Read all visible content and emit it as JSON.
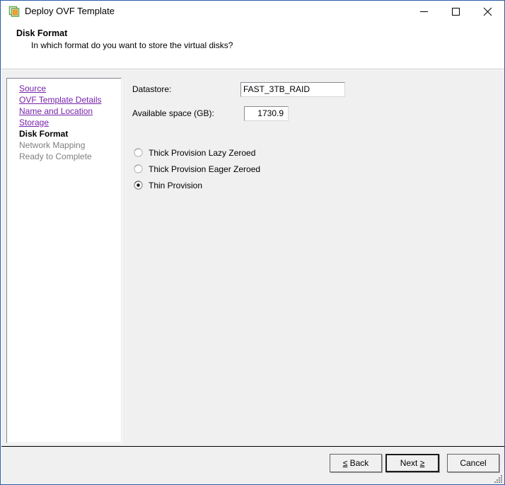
{
  "window": {
    "title": "Deploy OVF Template",
    "icon": "ovf-template-icon",
    "controls": {
      "minimize_label": "Minimize",
      "maximize_label": "Maximize",
      "close_label": "Close"
    },
    "border_color": "#2b5ea7"
  },
  "header": {
    "title": "Disk Format",
    "subtitle": "In which format do you want to store the virtual disks?"
  },
  "nav": {
    "items": [
      {
        "label": "Source",
        "state": "link"
      },
      {
        "label": "OVF Template Details",
        "state": "link"
      },
      {
        "label": "Name and Location",
        "state": "link"
      },
      {
        "label": "Storage",
        "state": "link"
      },
      {
        "label": "Disk Format",
        "state": "current"
      },
      {
        "label": "Network Mapping",
        "state": "pending"
      },
      {
        "label": "Ready to Complete",
        "state": "pending"
      }
    ],
    "link_color": "#7722aa",
    "pending_color": "#808080"
  },
  "form": {
    "datastore": {
      "label": "Datastore:",
      "value": "FAST_3TB_RAID"
    },
    "available_space": {
      "label": "Available space (GB):",
      "value": "1730.9"
    },
    "provision_options": [
      {
        "label": "Thick Provision Lazy Zeroed",
        "selected": false
      },
      {
        "label": "Thick Provision Eager Zeroed",
        "selected": false
      },
      {
        "label": "Thin Provision",
        "selected": true
      }
    ]
  },
  "footer": {
    "back": {
      "prefix": "≤",
      "label": " Back",
      "default": false
    },
    "next": {
      "prefix": "Next ",
      "label": "≥",
      "default": true
    },
    "cancel": {
      "label": "Cancel",
      "default": false
    }
  }
}
